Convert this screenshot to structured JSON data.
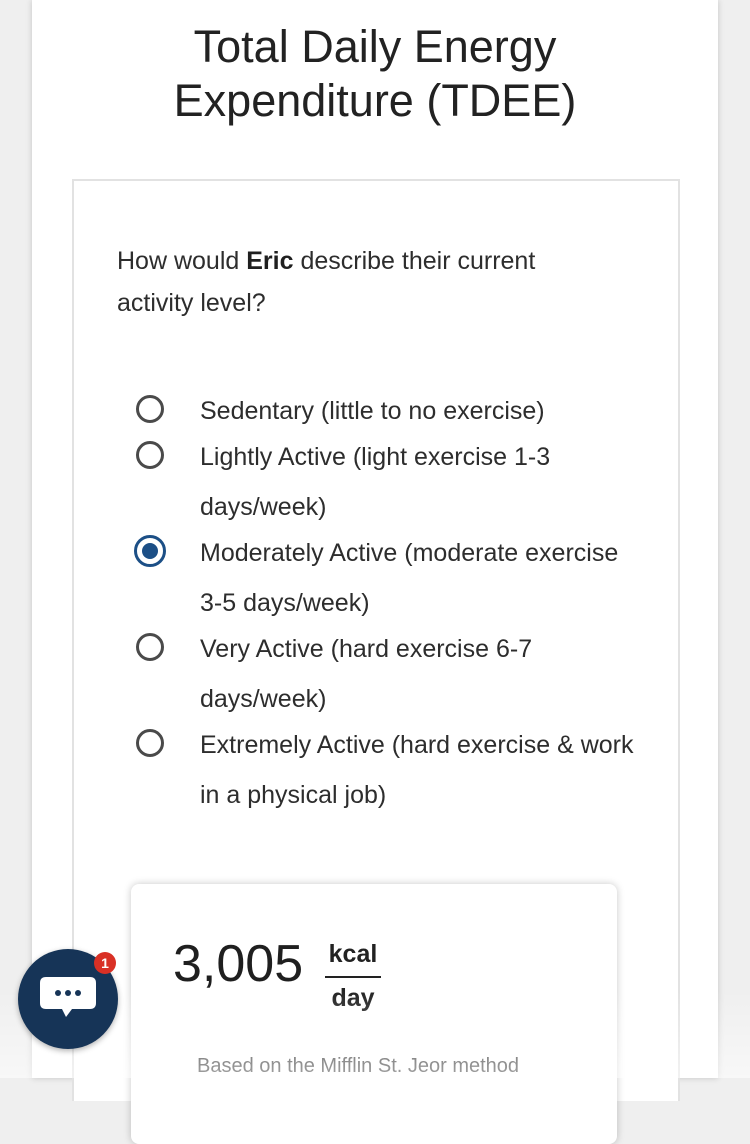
{
  "header": {
    "title_line1": "Total Daily Energy",
    "title_line2": "Expenditure (TDEE)"
  },
  "question": {
    "prefix": "How would ",
    "name": "Eric",
    "suffix": " describe their current activity level?"
  },
  "activity_options": [
    {
      "label": "Sedentary (little to no exercise)",
      "selected": false
    },
    {
      "label": "Lightly Active (light exercise 1-3 days/week)",
      "selected": false
    },
    {
      "label": "Moderately Active (moderate exercise 3-5 days/week)",
      "selected": true
    },
    {
      "label": "Very Active (hard exercise 6-7 days/week)",
      "selected": false
    },
    {
      "label": "Extremely Active (hard exercise & work in a physical job)",
      "selected": false
    }
  ],
  "result": {
    "value": "3,005",
    "unit_numerator": "kcal",
    "unit_denominator": "day",
    "method": "Based on the Mifflin St. Jeor method"
  },
  "chat": {
    "icon": "chat-bubble-icon",
    "badge_count": "1"
  },
  "colors": {
    "accent": "#1c4f86",
    "chat_button": "#163457",
    "badge": "#d93025"
  }
}
